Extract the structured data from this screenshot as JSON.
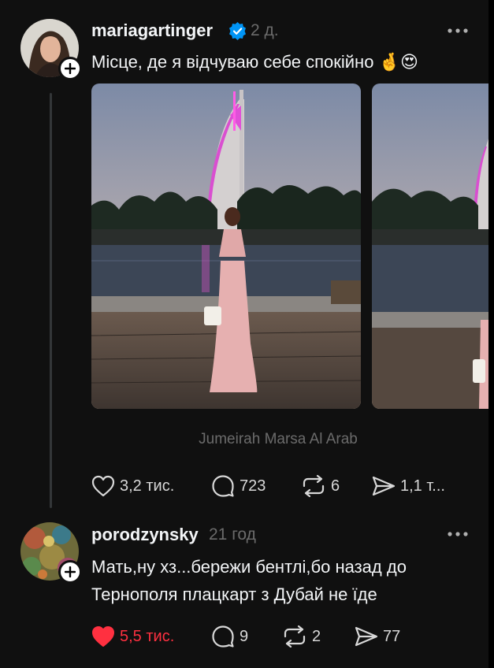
{
  "post": {
    "author": "mariagartinger",
    "time": "2 д.",
    "text": "Місце, де я відчуваю себе спокійно",
    "emoji_1": "🤞",
    "emoji_2": "😍",
    "location": "Jumeirah Marsa Al Arab",
    "stats": {
      "likes": "3,2 тис.",
      "comments": "723",
      "reposts": "6",
      "shares": "1,1 т..."
    }
  },
  "reply": {
    "author": "porodzynsky",
    "time": "21 год",
    "text_line1": "Мать,ну хз...бережи бентлі,бо назад до",
    "text_line2": "Тернополя плацкарт з Дубай не їде",
    "stats": {
      "likes": "5,5 тис.",
      "comments": "9",
      "reposts": "2",
      "shares": "77"
    }
  },
  "colors": {
    "background": "#101010",
    "text": "#f3f5f7",
    "muted": "#6b6b6b",
    "like_active": "#ff3040",
    "verified": "#0095f6"
  },
  "icons": [
    "verified-icon",
    "more-icon",
    "plus-icon",
    "heart-icon",
    "comment-icon",
    "repost-icon",
    "share-icon"
  ]
}
